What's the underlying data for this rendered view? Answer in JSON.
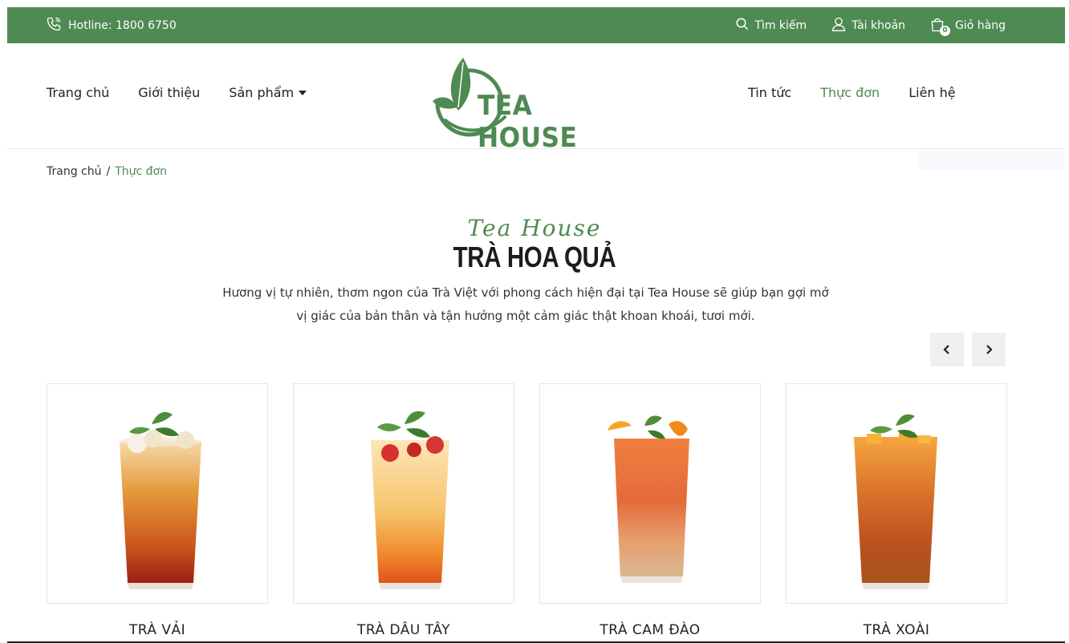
{
  "topbar": {
    "hotline": "Hotline: 1800 6750",
    "search": "Tìm kiếm",
    "account": "Tài khoản",
    "cart": "Giỏ hàng",
    "cart_count": "0"
  },
  "nav": {
    "left": [
      "Trang chủ",
      "Giới thiệu",
      "Sản phẩm"
    ],
    "right": [
      "Tin tức",
      "Thực đơn",
      "Liên hệ"
    ]
  },
  "logo": {
    "text": "TEA HOUSE"
  },
  "breadcrumb": {
    "home": "Trang chủ",
    "separator": "/",
    "current": "Thực đơn"
  },
  "section": {
    "script": "Tea House",
    "title": "TRÀ HOA QUẢ",
    "desc_line1": "Hương vị tự nhiên, thơm ngon của Trà Việt với phong cách hiện đại tại Tea House sẽ giúp bạn gợi mở",
    "desc_line2": "vị giác của bản thân và tận hưởng một cảm giác thật khoan khoái, tươi mới."
  },
  "products": [
    {
      "name": "TRÀ VẢI"
    },
    {
      "name": "TRÀ DÂU TÂY"
    },
    {
      "name": "TRÀ CAM ĐÀO"
    },
    {
      "name": "TRÀ XOÀI"
    }
  ],
  "colors": {
    "brand": "#4e8a52",
    "text": "#222222"
  }
}
